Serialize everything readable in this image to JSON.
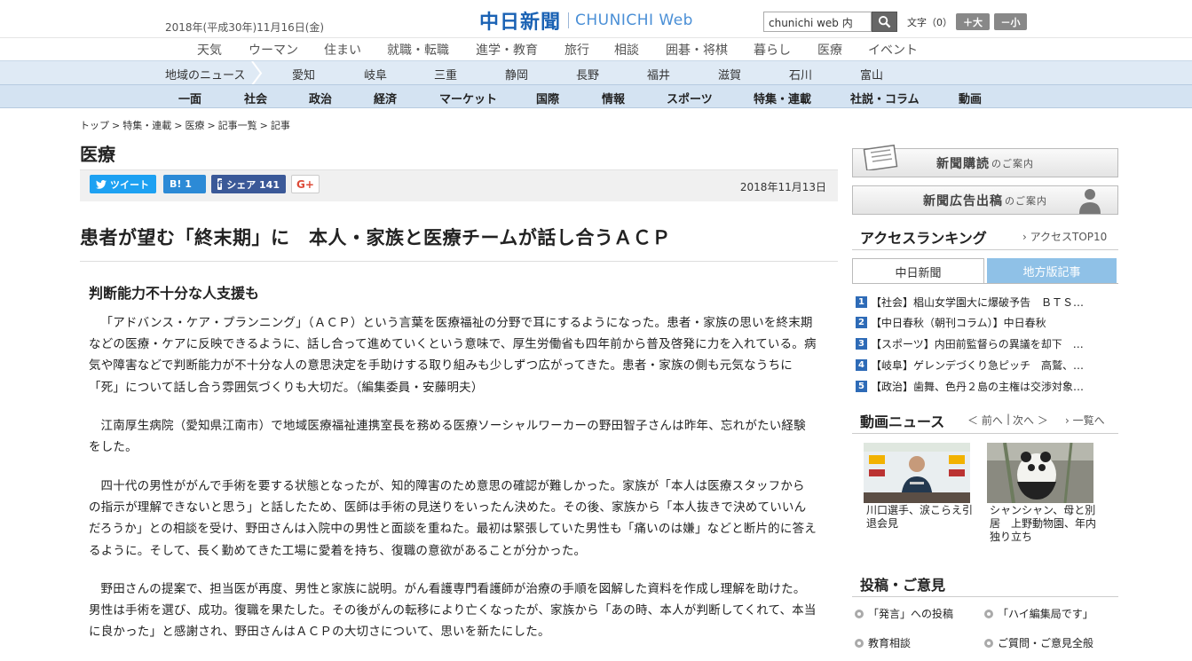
{
  "header": {
    "date": "2018年(平成30年)11月16日(金)",
    "logo_ja": "中日新聞",
    "logo_en": "CHUNICHI Web",
    "search_value": "chunichi web 内",
    "fontsize_label": "文字（0）",
    "font_plus": "＋大",
    "font_minus": "－小"
  },
  "categories": [
    "天気",
    "ウーマン",
    "住まい",
    "就職・転職",
    "進学・教育",
    "旅行",
    "相談",
    "囲碁・将棋",
    "暮らし",
    "医療",
    "イベント"
  ],
  "region": {
    "label": "地域のニュース",
    "items": [
      "愛知",
      "岐阜",
      "三重",
      "静岡",
      "長野",
      "福井",
      "滋賀",
      "石川",
      "富山"
    ]
  },
  "sections": [
    "一面",
    "社会",
    "政治",
    "経済",
    "マーケット",
    "国際",
    "情報",
    "スポーツ",
    "特集・連載",
    "社説・コラム",
    "動画"
  ],
  "breadcrumb": [
    "トップ",
    ">",
    "特集・連載",
    ">",
    "医療",
    ">",
    "記事一覧",
    ">",
    "記事"
  ],
  "section_title": "医療",
  "share": {
    "tweet": "ツイート",
    "hatena": "B! 1",
    "facebook": "シェア 141",
    "gplus": "G+"
  },
  "article": {
    "date": "2018年11月13日",
    "headline": "患者が望む「終末期」に　本人・家族と医療チームが話し合うＡＣＰ",
    "subhead": "判断能力不十分な人支援も",
    "paragraphs": [
      "「アドバンス・ケア・プランニング」（ＡＣＰ）という言葉を医療福祉の分野で耳にするようになった。患者・家族の思いを終末期などの医療・ケアに反映できるように、話し合って進めていくという意味で、厚生労働省も四年前から普及啓発に力を入れている。病気や障害などで判断能力が不十分な人の意思決定を手助けする取り組みも少しずつ広がってきた。患者・家族の側も元気なうちに「死」について話し合う雰囲気づくりも大切だ。（編集委員・安藤明夫）",
      "江南厚生病院（愛知県江南市）で地域医療福祉連携室長を務める医療ソーシャルワーカーの野田智子さんは昨年、忘れがたい経験をした。",
      "四十代の男性ががんで手術を要する状態となったが、知的障害のため意思の確認が難しかった。家族が「本人は医療スタッフからの指示が理解できないと思う」と話したため、医師は手術の見送りをいったん決めた。その後、家族から「本人抜きで決めていいんだろうか」との相談を受け、野田さんは入院中の男性と面談を重ねた。最初は緊張していた男性も「痛いのは嫌」などと断片的に答えるように。そして、長く勤めてきた工場に愛着を持ち、復職の意欲があることが分かった。",
      "野田さんの提案で、担当医が再度、男性と家族に説明。がん看護専門看護師が治療の手順を図解した資料を作成し理解を助けた。男性は手術を選び、成功。復職を果たした。その後がんの転移により亡くなったが、家族から「あの時、本人が判断してくれて、本当に良かった」と感謝され、野田さんはＡＣＰの大切さについて、思いを新たにした。"
    ]
  },
  "sidebar": {
    "banner_subscribe": "新聞購読",
    "banner_subscribe_small": "のご案内",
    "banner_ad": "新聞広告出稿",
    "banner_ad_small": "のご案内",
    "ranking_title": "アクセスランキング",
    "ranking_link": "› アクセスTOP10",
    "tab_main": "中日新聞",
    "tab_local": "地方版記事",
    "ranking": [
      {
        "n": "1",
        "text": "【社会】椙山女学園大に爆破予告　ＢＴＳ…"
      },
      {
        "n": "2",
        "text": "【中日春秋（朝刊コラム）】中日春秋"
      },
      {
        "n": "3",
        "text": "【スポーツ】内田前監督らの異議を却下　…"
      },
      {
        "n": "4",
        "text": "【岐阜】ゲレンデづくり急ピッチ　高鷲、…"
      },
      {
        "n": "5",
        "text": "【政治】歯舞、色丹２島の主権は交渉対象…"
      }
    ],
    "video_title": "動画ニュース",
    "video_prev": "＜ 前へ",
    "video_sep": "|",
    "video_next": "次へ ＞",
    "video_list": "› 一覧へ",
    "videos": [
      {
        "caption": "川口選手、涙こらえ引退会見"
      },
      {
        "caption": "シャンシャン、母と別居　上野動物園、年内独り立ち"
      }
    ],
    "post_title": "投稿・ご意見",
    "posts": [
      "「発言」への投稿",
      "「ハイ編集局です」",
      "教育相談",
      "ご質問・ご意見全般"
    ]
  }
}
